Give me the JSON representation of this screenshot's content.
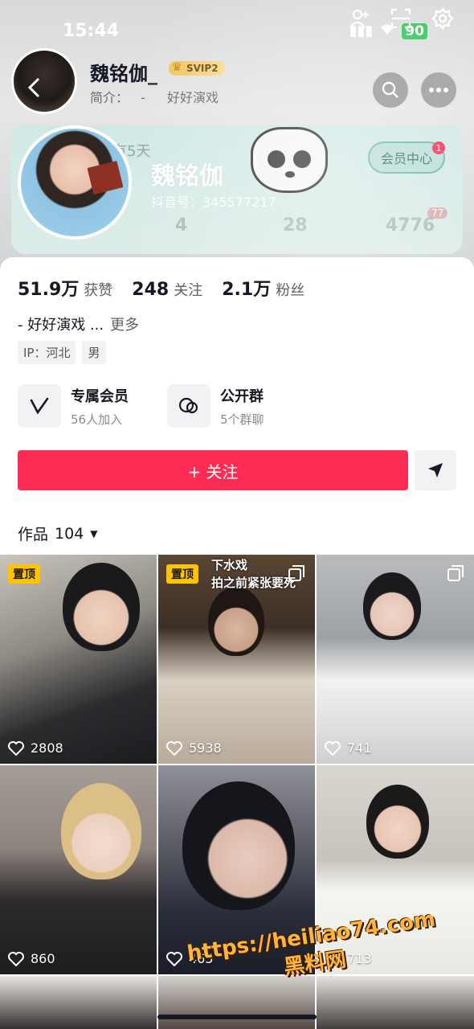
{
  "status_bar": {
    "time": "15:44",
    "battery": "90"
  },
  "header": {
    "name": "魏铭伽_",
    "svip_badge": "SVIP2",
    "bio_label": "简介：",
    "bio_dash": "-",
    "bio_text": "好好演戏"
  },
  "profile_card": {
    "faint_days": "有5天",
    "display_name": "魏铭伽",
    "douyin_id": "抖音号：345577217",
    "vip_center_label": "会员中心",
    "vip_center_badge": "1",
    "faint_stats": [
      "4",
      "28",
      "4776"
    ],
    "faint_badge": "77"
  },
  "stats": [
    {
      "value": "51.9万",
      "label": "获赞"
    },
    {
      "value": "248",
      "label": "关注"
    },
    {
      "value": "2.1万",
      "label": "粉丝"
    }
  ],
  "bio_line": {
    "text": "- 好好演戏 ...",
    "more": "更多"
  },
  "tags": [
    "IP：河北",
    "男"
  ],
  "features": [
    {
      "title": "专属会员",
      "subtitle": "56人加入",
      "icon": "v-member-icon"
    },
    {
      "title": "公开群",
      "subtitle": "5个群聊",
      "icon": "chat-bubbles-icon"
    }
  ],
  "follow_button": "+ 关注",
  "works_tab": {
    "label": "作品",
    "count": "104"
  },
  "grid": [
    {
      "pinned": "置顶",
      "likes": "2808",
      "caption": "",
      "multi": false
    },
    {
      "pinned": "置顶",
      "likes": "5938",
      "caption": "下水戏\n拍之前紧张要死",
      "multi": true
    },
    {
      "pinned": "",
      "likes": "741",
      "caption": "",
      "multi": true
    },
    {
      "pinned": "",
      "likes": "860",
      "caption": "",
      "multi": false
    },
    {
      "pinned": "",
      "likes": "465",
      "caption": "",
      "multi": false
    },
    {
      "pinned": "",
      "likes": "713",
      "caption": "",
      "multi": false
    }
  ],
  "watermark": {
    "line1": "https://heiliao74.com",
    "line2": "黑料网"
  },
  "colors": {
    "accent": "#fe2c55",
    "pin": "#ffc300",
    "card": "#cde9e5"
  }
}
